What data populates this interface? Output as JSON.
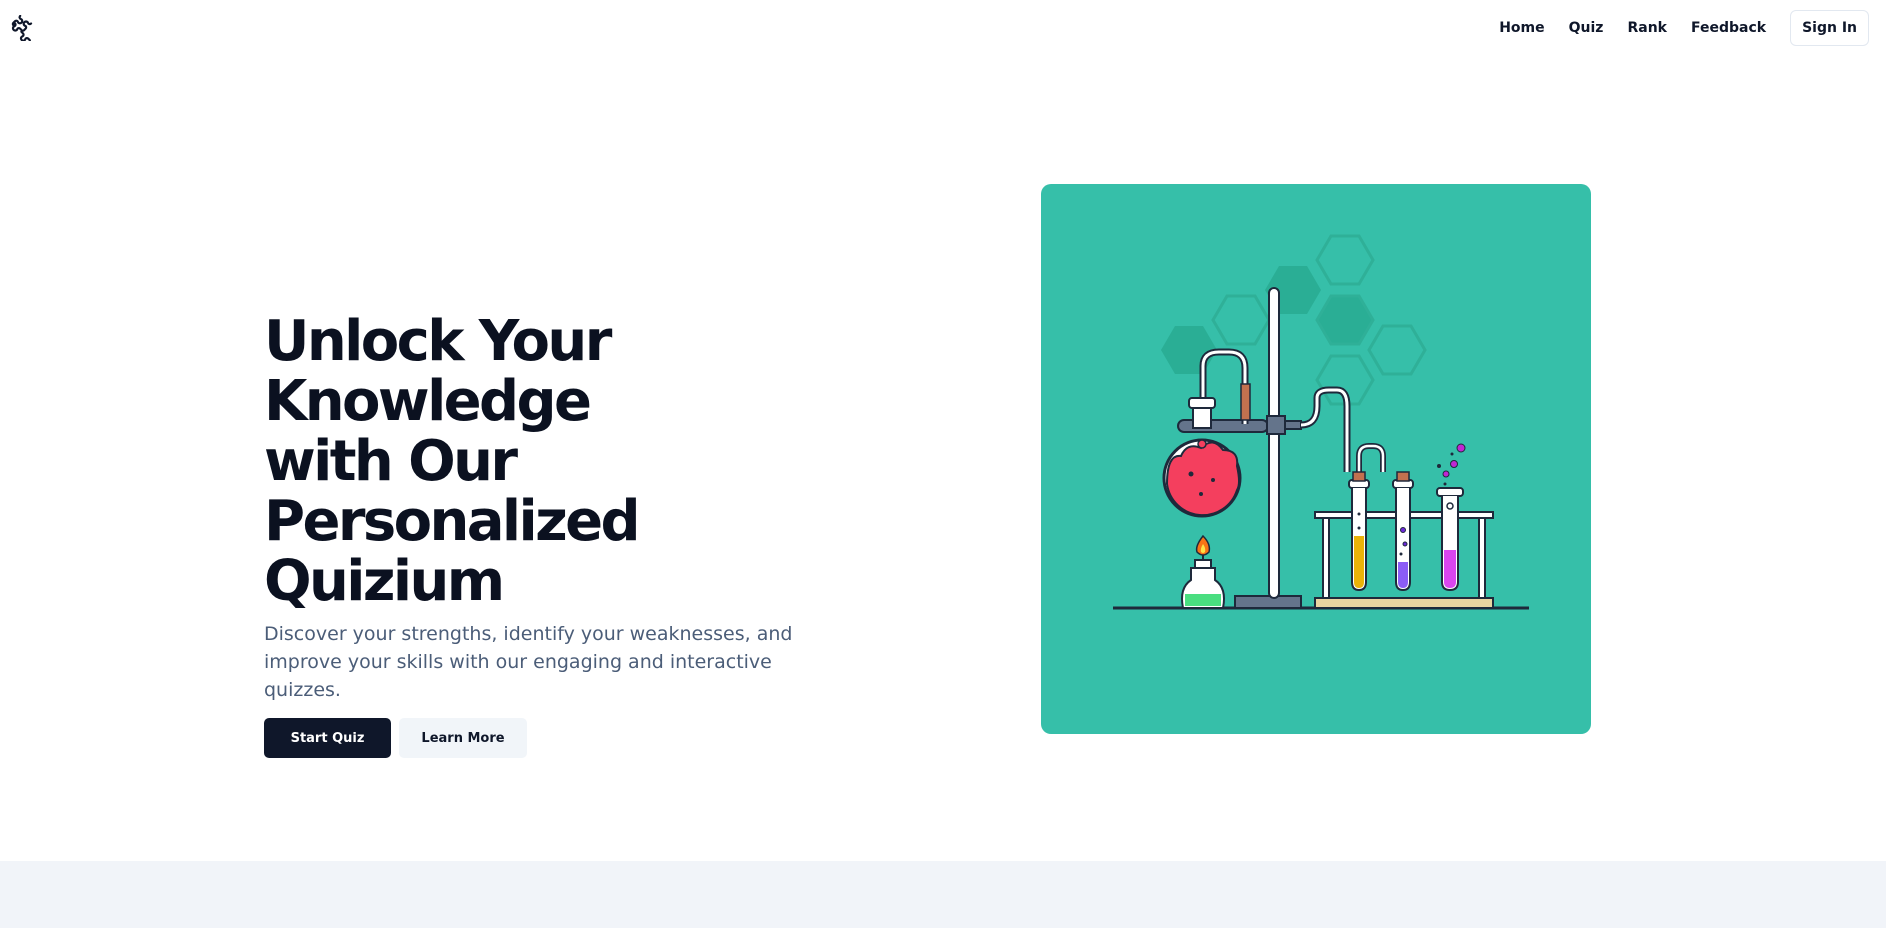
{
  "header": {
    "logo_icon": "puzzle-piece-icon",
    "nav": [
      {
        "label": "Home"
      },
      {
        "label": "Quiz"
      },
      {
        "label": "Rank"
      },
      {
        "label": "Feedback"
      }
    ],
    "signin_label": "Sign In"
  },
  "hero": {
    "title_lines": [
      "Unlock Your Knowledge",
      "with Our Personalized",
      "Quizium"
    ],
    "subtitle": "Discover your strengths, identify your weaknesses, and improve your skills with our engaging and interactive quizzes.",
    "primary_button": "Start Quiz",
    "secondary_button": "Learn More"
  },
  "illustration": {
    "subject": "chemistry lab equipment",
    "background_color": "#36bfa9"
  },
  "colors": {
    "primary": "#0f172a",
    "muted_text": "#4b5d78",
    "secondary_bg": "#f1f5f9",
    "teal": "#36bfa9",
    "section_bg": "#f1f4f9"
  }
}
